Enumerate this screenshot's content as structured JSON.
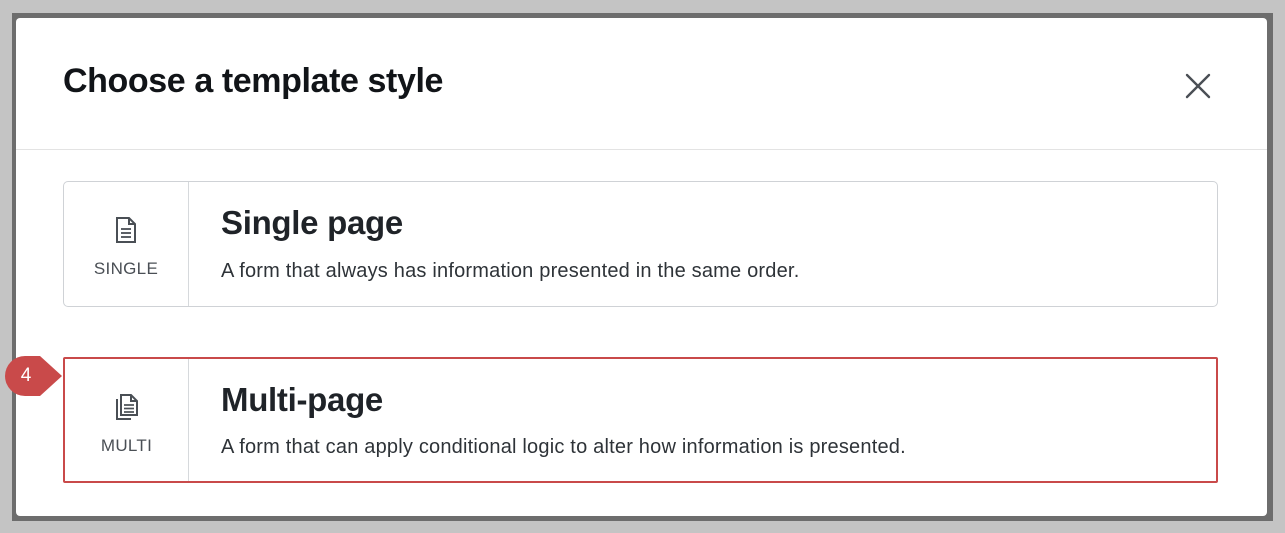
{
  "modal": {
    "title": "Choose a template style",
    "close_icon": "close-icon"
  },
  "options": [
    {
      "code": "SINGLE",
      "icon": "document-icon",
      "title": "Single page",
      "description": "A form that always has information presented in the same order."
    },
    {
      "code": "MULTI",
      "icon": "documents-stack-icon",
      "title": "Multi-page",
      "description": "A form that can apply conditional logic to alter how information is presented."
    }
  ],
  "callout": {
    "step": "4",
    "color": "#c94a4a"
  }
}
